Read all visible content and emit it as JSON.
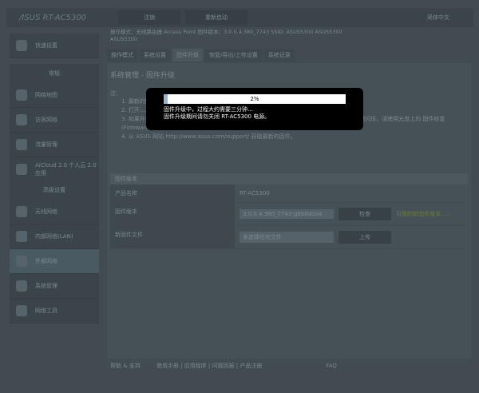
{
  "header": {
    "logo": "/ISUS",
    "model": "RT-AC5300",
    "logout": "注销",
    "reboot": "重新启动",
    "language": "简体中文"
  },
  "info": {
    "text": "操作模式：无线路由器 Access Point  固件版本：3.0.0.4.380_7743  SSID: ASUS5300  ASUS5300",
    "text2": "ASUS5300"
  },
  "tabs": [
    "操作模式",
    "系统设置",
    "固件升级",
    "恢复/导出/上传设置",
    "系统记录"
  ],
  "sidebar": {
    "quick": "快速设置",
    "general": "常规",
    "general_items": [
      "网络地图",
      "访客网络",
      "流量管理",
      "AiCloud 2.0 个人云 2.0 应用"
    ],
    "advanced": "高级设置",
    "advanced_items": [
      "无线网络",
      "内部网络(LAN)",
      "外部网络",
      "系统管理",
      "网络工具"
    ]
  },
  "page": {
    "title": "系统管理 - 固件升级",
    "note": "注：",
    "notes": [
      "1. 最新的固件版本……",
      "2. 打开……",
      "3. 如果升级失败，RT-AC5300 将自动进入救援模式，此 RT-AC5300 前面板的 LED 指示灯会缓慢闪烁，请使用光盘上的 固件修复 (Firmware Restoration) 应用程序进行系统恢复。",
      "4. 从 ASUS 网站 http://www.asus.com/support/ 获取最新的固件。"
    ]
  },
  "fw": {
    "section": "固件版本",
    "product_label": "产品名称",
    "product": "RT-AC5300",
    "version_label": "固件版本",
    "version": "3.0.0.4.380_7743-g8b6dda4",
    "check": "检查",
    "version_note": "可用的新固件版本……",
    "file_label": "新固件文件",
    "file": "未选择任何文件",
    "upload": "上传"
  },
  "footer": {
    "help": "帮助 & 支持",
    "links": "使用手册 | 应用程序 | 问题回报 | 产品注册",
    "faq": "FAQ"
  },
  "modal": {
    "progress_percent": 2,
    "progress_label": "2%",
    "line1": "固件升级中，过程大约需要三分钟…",
    "line2": "固件升级期间请勿关闭 RT-AC5300 电源。"
  }
}
